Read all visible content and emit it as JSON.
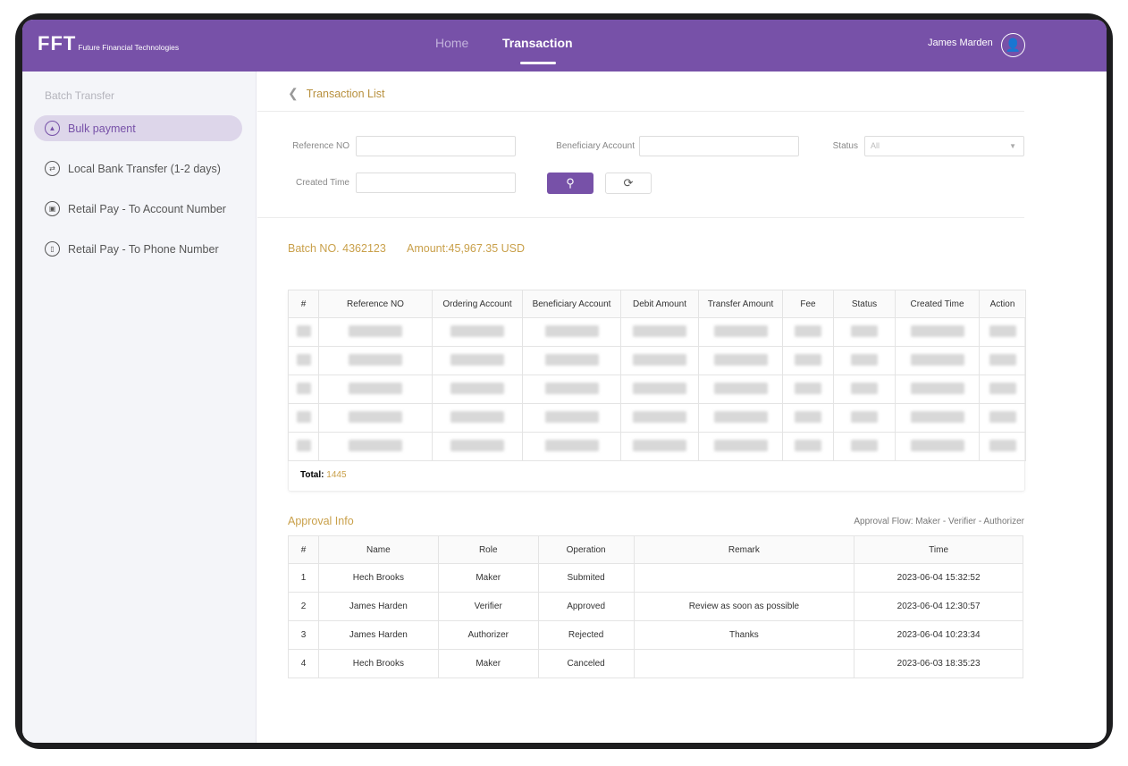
{
  "header": {
    "logo": "FFT",
    "logo_sub": "Future Financial Technologies",
    "nav": [
      "Home",
      "Transaction"
    ],
    "active_nav": "Transaction",
    "user_name": "James Marden",
    "brand_color": "#7751a8"
  },
  "sidebar": {
    "title": "Batch Transfer",
    "items": [
      {
        "label": "Bulk payment",
        "icon": "user-icon",
        "active": true
      },
      {
        "label": "Local Bank Transfer (1-2 days)",
        "icon": "transfer-icon"
      },
      {
        "label": "Retail Pay - To Account Number",
        "icon": "wallet-icon"
      },
      {
        "label": "Retail Pay - To Phone Number",
        "icon": "phone-icon"
      }
    ]
  },
  "breadcrumb": {
    "label": "Transaction List"
  },
  "filters": {
    "reference_label": "Reference NO",
    "reference_value": "",
    "beneficiary_label": "Beneficiary Account",
    "beneficiary_value": "",
    "status_label": "Status",
    "status_value": "All",
    "created_label": "Created Time",
    "created_value": ""
  },
  "batch": {
    "batch_no": "Batch NO. 4362123",
    "amount": "Amount:45,967.35 USD",
    "columns": [
      "#",
      "Reference NO",
      "Ordering Account",
      "Beneficiary Account",
      "Debit Amount",
      "Transfer Amount",
      "Fee",
      "Status",
      "Created Time",
      "Action"
    ],
    "row_count_shown": 5,
    "total_label": "Total:",
    "total_value": "1445"
  },
  "approval": {
    "title": "Approval Info",
    "flow": "Approval Flow: Maker - Verifier - Authorizer",
    "columns": [
      "#",
      "Name",
      "Role",
      "Operation",
      "Remark",
      "Time"
    ],
    "rows": [
      [
        "1",
        "Hech Brooks",
        "Maker",
        "Submited",
        "",
        "2023-06-04 15:32:52"
      ],
      [
        "2",
        "James Harden",
        "Verifier",
        "Approved",
        "Review as soon as possible",
        "2023-06-04 12:30:57"
      ],
      [
        "3",
        "James Harden",
        "Authorizer",
        "Rejected",
        "Thanks",
        "2023-06-04 10:23:34"
      ],
      [
        "4",
        "Hech Brooks",
        "Maker",
        "Canceled",
        "",
        "2023-06-03 18:35:23"
      ]
    ]
  }
}
